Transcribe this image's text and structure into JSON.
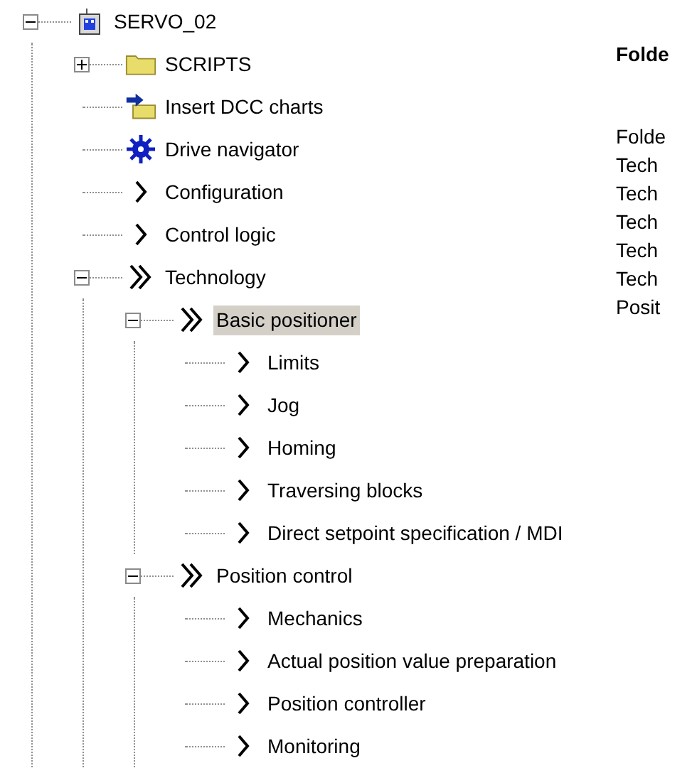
{
  "tree": [
    {
      "label": "SERVO_02",
      "kind": "device",
      "expanded": true,
      "selected": false,
      "children": [
        {
          "label": "SCRIPTS",
          "kind": "folder",
          "expanded": false,
          "selected": false
        },
        {
          "label": "Insert DCC charts",
          "kind": "dcc",
          "selected": false
        },
        {
          "label": "Drive navigator",
          "kind": "navigator",
          "selected": false
        },
        {
          "label": "Configuration",
          "kind": "single",
          "selected": false
        },
        {
          "label": "Control logic",
          "kind": "single",
          "selected": false
        },
        {
          "label": "Technology",
          "kind": "double",
          "expanded": true,
          "selected": false,
          "children": [
            {
              "label": "Basic positioner",
              "kind": "double",
              "expanded": true,
              "selected": true,
              "children": [
                {
                  "label": "Limits",
                  "kind": "single",
                  "selected": false
                },
                {
                  "label": "Jog",
                  "kind": "single",
                  "selected": false
                },
                {
                  "label": "Homing",
                  "kind": "single",
                  "selected": false
                },
                {
                  "label": "Traversing blocks",
                  "kind": "single",
                  "selected": false
                },
                {
                  "label": "Direct setpoint specification / MDI",
                  "kind": "single",
                  "selected": false
                }
              ]
            },
            {
              "label": "Position control",
              "kind": "double",
              "expanded": true,
              "selected": false,
              "children": [
                {
                  "label": "Mechanics",
                  "kind": "single",
                  "selected": false
                },
                {
                  "label": "Actual position value preparation",
                  "kind": "single",
                  "selected": false
                },
                {
                  "label": "Position controller",
                  "kind": "single",
                  "selected": false
                },
                {
                  "label": "Monitoring",
                  "kind": "single",
                  "selected": false
                }
              ]
            }
          ]
        }
      ]
    }
  ],
  "side_panel": {
    "heading": "Folde",
    "lines": [
      "Folde",
      "Tech",
      "Tech",
      "Tech",
      "Tech",
      "Tech",
      "Posit"
    ]
  }
}
